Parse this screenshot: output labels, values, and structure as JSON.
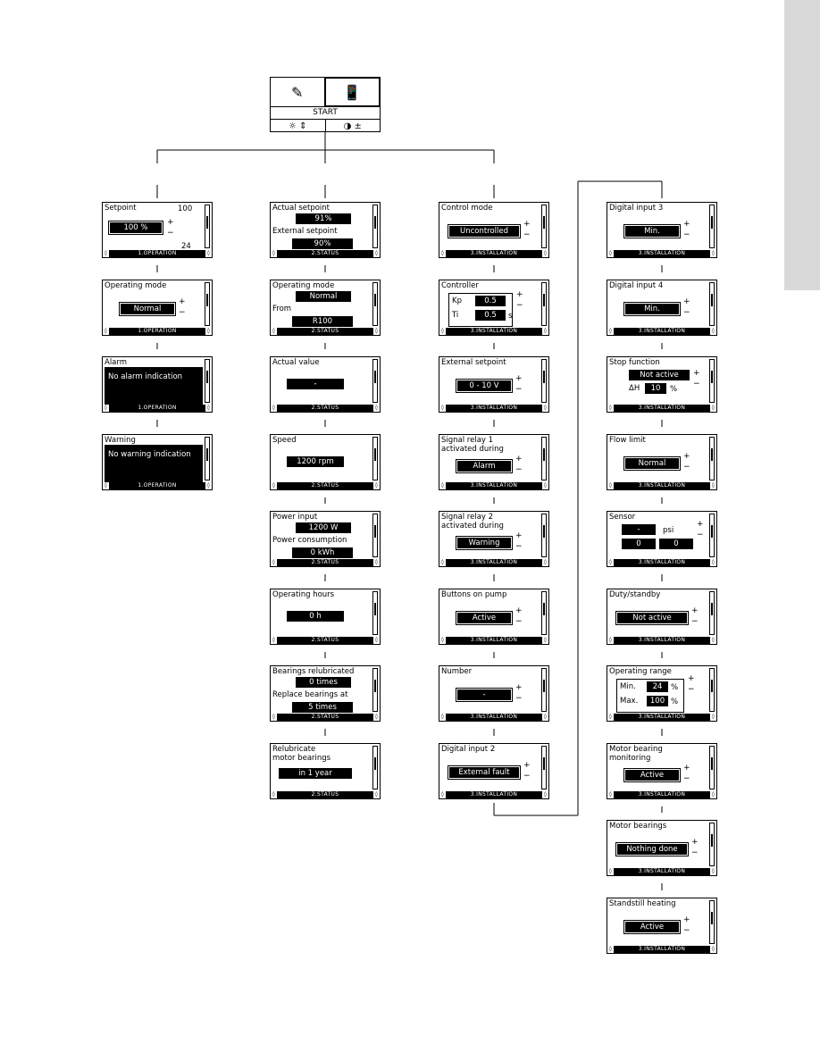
{
  "start": {
    "label": "START",
    "icons": [
      "service-menu-icon",
      "remote-control-icon",
      "brightness-icon",
      "contrast-icon"
    ]
  },
  "operation": [
    {
      "title": "Setpoint",
      "value": "100 %",
      "scale_max": "100",
      "scale_min": "24",
      "footer": "1.OPERATION"
    },
    {
      "title": "Operating mode",
      "value": "Normal",
      "footer": "1.OPERATION"
    },
    {
      "title": "Alarm",
      "message": "No alarm indication",
      "footer": "1.OPERATION"
    },
    {
      "title": "Warning",
      "message": "No warning indication",
      "footer": "1.OPERATION"
    }
  ],
  "status": [
    {
      "title": "Actual setpoint",
      "value": "91%",
      "title2": "External setpoint",
      "value2": "90%",
      "footer": "2.STATUS"
    },
    {
      "title": "Operating mode",
      "value": "Normal",
      "title2": "From",
      "value2": "R100",
      "footer": "2.STATUS"
    },
    {
      "title": "Actual value",
      "value": "-",
      "footer": "2.STATUS"
    },
    {
      "title": "Speed",
      "value": "1200 rpm",
      "footer": "2.STATUS"
    },
    {
      "title": "Power input",
      "value": "1200 W",
      "title2": "Power consumption",
      "value2": "0 kWh",
      "footer": "2.STATUS"
    },
    {
      "title": "Operating hours",
      "value": "0 h",
      "footer": "2.STATUS"
    },
    {
      "title": "Bearings relubricated",
      "value": "0 times",
      "title2": "Replace bearings at",
      "value2": "5 times",
      "footer": "2.STATUS"
    },
    {
      "title": "Relubricate",
      "title_line2": "motor bearings",
      "value": "in 1 year",
      "footer": "2.STATUS"
    }
  ],
  "installation_a": [
    {
      "title": "Control mode",
      "value": "Uncontrolled",
      "footer": "3.INSTALLATION"
    },
    {
      "title": "Controller",
      "kp_label": "Kp",
      "kp_value": "0.5",
      "ti_label": "Ti",
      "ti_value": "0.5",
      "ti_unit": "s",
      "footer": "3.INSTALLATION"
    },
    {
      "title": "External setpoint",
      "value": "0 - 10 V",
      "footer": "3.INSTALLATION"
    },
    {
      "title": "Signal relay 1",
      "title_line2": "activated during",
      "value": "Alarm",
      "footer": "3.INSTALLATION"
    },
    {
      "title": "Signal relay 2",
      "title_line2": "activated during",
      "value": "Warning",
      "footer": "3.INSTALLATION"
    },
    {
      "title": "Buttons on pump",
      "value": "Active",
      "footer": "3.INSTALLATION"
    },
    {
      "title": "Number",
      "value": "-",
      "footer": "3.INSTALLATION"
    },
    {
      "title": "Digital input 2",
      "value": "External fault",
      "footer": "3.INSTALLATION"
    }
  ],
  "installation_b": [
    {
      "title": "Digital input 3",
      "value": "Min.",
      "footer": "3.INSTALLATION"
    },
    {
      "title": "Digital input 4",
      "value": "Min.",
      "footer": "3.INSTALLATION"
    },
    {
      "title": "Stop function",
      "value": "Not active",
      "dh_label": "ΔH",
      "dh_value": "10",
      "dh_unit": "%",
      "footer": "3.INSTALLATION"
    },
    {
      "title": "Flow limit",
      "value": "Normal",
      "footer": "3.INSTALLATION"
    },
    {
      "title": "Sensor",
      "value": "-",
      "unit": "psi",
      "min": "0",
      "max": "0",
      "footer": "3.INSTALLATION"
    },
    {
      "title": "Duty/standby",
      "value": "Not active",
      "footer": "3.INSTALLATION"
    },
    {
      "title": "Operating range",
      "min_label": "Min.",
      "min_value": "24",
      "max_label": "Max.",
      "max_value": "100",
      "unit": "%",
      "footer": "3.INSTALLATION"
    },
    {
      "title": "Motor bearing",
      "title_line2": "monitoring",
      "value": "Active",
      "footer": "3.INSTALLATION"
    },
    {
      "title": "Motor bearings",
      "value": "Nothing done",
      "footer": "3.INSTALLATION"
    },
    {
      "title": "Standstill heating",
      "value": "Active",
      "footer": "3.INSTALLATION"
    }
  ],
  "glyphs": {
    "plus": "+",
    "minus": "−",
    "nav_left": "◊",
    "nav_right": "◊"
  }
}
